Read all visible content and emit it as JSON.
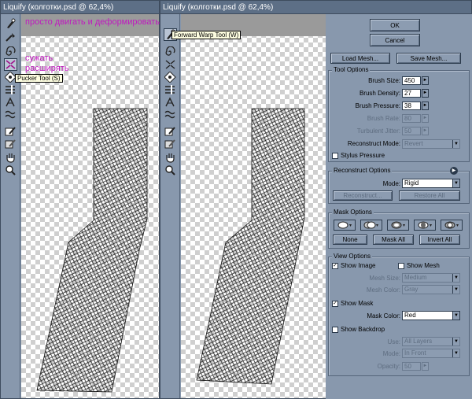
{
  "window1": {
    "title": "Liquify (колготки.psd @ 62,4%)",
    "tooltip": "Pucker Tool (S)",
    "notes": {
      "deform": "просто двигать и деформировать",
      "shrink": "сужать",
      "expand": "расширять"
    }
  },
  "window2": {
    "title": "Liquify (колготки.psd @ 62,4%)",
    "tooltip": "Forward Warp Tool (W)"
  },
  "tools": [
    "forward-warp-icon",
    "reconstruct-icon",
    "twirl-icon",
    "pucker-icon",
    "bloat-icon",
    "push-left-icon",
    "mirror-icon",
    "turbulence-icon",
    "freeze-mask-icon",
    "thaw-mask-icon",
    "hand-icon",
    "zoom-icon"
  ],
  "buttons": {
    "ok": "OK",
    "cancel": "Cancel",
    "load_mesh": "Load Mesh...",
    "save_mesh": "Save Mesh..."
  },
  "tool_options": {
    "heading": "Tool Options",
    "brush_size": {
      "label": "Brush Size:",
      "value": "450"
    },
    "brush_density": {
      "label": "Brush Density:",
      "value": "27"
    },
    "brush_pressure": {
      "label": "Brush Pressure:",
      "value": "38"
    },
    "brush_rate": {
      "label": "Brush Rate:",
      "value": "80"
    },
    "turbulent_jitter": {
      "label": "Turbulent Jitter:",
      "value": "50"
    },
    "reconstruct_mode": {
      "label": "Reconstruct Mode:",
      "value": "Revert"
    },
    "stylus_pressure": "Stylus Pressure"
  },
  "reconstruct_options": {
    "heading": "Reconstruct Options",
    "mode_label": "Mode:",
    "mode_value": "Rigid",
    "reconstruct": "Reconstruct...",
    "restore_all": "Restore All"
  },
  "mask_options": {
    "heading": "Mask Options",
    "none": "None",
    "mask_all": "Mask All",
    "invert_all": "Invert All"
  },
  "view_options": {
    "heading": "View Options",
    "show_image": "Show Image",
    "show_mesh": "Show Mesh",
    "mesh_size_label": "Mesh Size:",
    "mesh_size_value": "Medium",
    "mesh_color_label": "Mesh Color:",
    "mesh_color_value": "Gray",
    "show_mask": "Show Mask",
    "mask_color_label": "Mask Color:",
    "mask_color_value": "Red",
    "show_backdrop": "Show Backdrop",
    "use_label": "Use:",
    "use_value": "All Layers",
    "mode_label": "Mode:",
    "mode_value": "In Front",
    "opacity_label": "Opacity:",
    "opacity_value": "50"
  }
}
